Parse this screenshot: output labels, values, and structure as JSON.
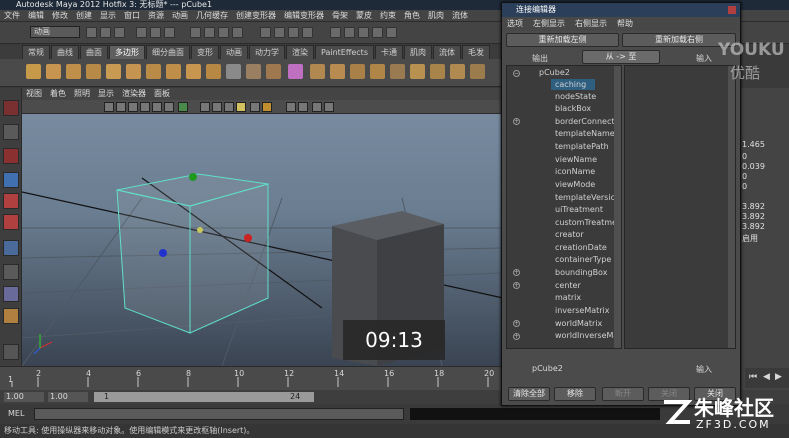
{
  "window": {
    "title": "Autodesk Maya 2012 Hotfix 3: 无标题*   ---   pCube1"
  },
  "menubar": [
    "文件",
    "编辑",
    "修改",
    "创建",
    "显示",
    "窗口",
    "资源",
    "动画",
    "几何缓存",
    "创建变形器",
    "编辑变形器",
    "骨架",
    "蒙皮",
    "约束",
    "角色",
    "肌肉",
    "流体"
  ],
  "status": {
    "mode": "动画"
  },
  "shelf_tabs": [
    {
      "label": "常规",
      "active": false
    },
    {
      "label": "曲线",
      "active": false
    },
    {
      "label": "曲面",
      "active": false
    },
    {
      "label": "多边形",
      "active": true
    },
    {
      "label": "细分曲面",
      "active": false
    },
    {
      "label": "变形",
      "active": false
    },
    {
      "label": "动画",
      "active": false
    },
    {
      "label": "动力学",
      "active": false
    },
    {
      "label": "渲染",
      "active": false
    },
    {
      "label": "PaintEffects",
      "active": false
    },
    {
      "label": "卡通",
      "active": false
    },
    {
      "label": "肌肉",
      "active": false
    },
    {
      "label": "流体",
      "active": false
    },
    {
      "label": "毛发",
      "active": false
    }
  ],
  "panel_menu": [
    "视图",
    "着色",
    "照明",
    "显示",
    "渲染器",
    "面板"
  ],
  "connection_editor": {
    "title": "连接编辑器",
    "menu": [
      "选项",
      "左侧显示",
      "右侧显示",
      "帮助"
    ],
    "reload_left": "重新加载左侧",
    "reload_right": "重新加载右侧",
    "output_label": "输出",
    "direction_button": "从 -> 至",
    "input_label": "输入",
    "left_node": "pCube2",
    "attributes": [
      "caching",
      "nodeState",
      "blackBox",
      "borderConnections",
      "templateName",
      "templatePath",
      "viewName",
      "iconName",
      "viewMode",
      "templateVersion",
      "uiTreatment",
      "customTreatment",
      "creator",
      "creationDate",
      "containerType",
      "boundingBox",
      "center",
      "matrix",
      "inverseMatrix",
      "worldMatrix",
      "worldInverseMatrix"
    ],
    "bottom_left_node": "pCube2",
    "bottom_input_label": "输入",
    "buttons": [
      "清除全部",
      "移除",
      "断开",
      "关闭",
      "关闭"
    ]
  },
  "channel_values": [
    "1.465",
    "0",
    "0.039",
    "0",
    "0",
    "3.892",
    "3.892",
    "3.892",
    "启用"
  ],
  "timeline": {
    "ticks": [
      "1",
      "2",
      "4",
      "6",
      "8",
      "10",
      "12",
      "14",
      "16",
      "18",
      "20",
      "22"
    ],
    "range_start": "1.00",
    "range_start2": "1.00",
    "current": "1",
    "range_end": "24"
  },
  "mel_label": "MEL",
  "help_text": "移动工具: 使用操纵器来移动对象。使用编辑模式来更改枢轴(Insert)。",
  "video": {
    "timecode": "09:13"
  },
  "watermarks": {
    "youku": "YOUKU",
    "youku_cn": "优酷",
    "zf": "朱峰社区",
    "zf_url": "ZF3D.COM"
  }
}
